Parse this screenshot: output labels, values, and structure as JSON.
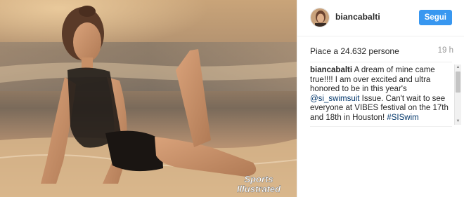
{
  "post": {
    "username": "biancabalti",
    "follow_label": "Segui",
    "likes_text": "Piace a 24.632 persone",
    "time_ago": "19 h",
    "caption": {
      "user": "biancabalti",
      "text_1": " A dream of mine came true!!!! I am over excited and ultra honored to be in this year's ",
      "mention": "@si_swimsuit",
      "text_2": " Issue. Can't wait to see everyone at VIBES festival on the 17th and 18th in Houston! ",
      "hashtag": "#SISwim"
    },
    "watermark": {
      "line1": "Sports",
      "line2": "Illustrated"
    }
  },
  "colors": {
    "follow_button": "#3897f0",
    "link": "#003569",
    "time": "#999999"
  },
  "icons": {
    "scroll_up": "▲",
    "scroll_down": "▼"
  }
}
